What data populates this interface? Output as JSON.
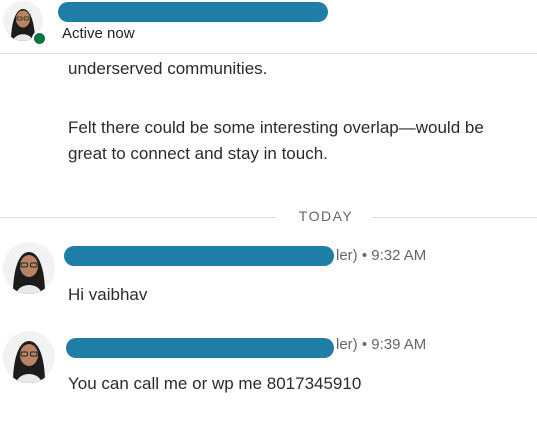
{
  "header": {
    "contact_name": "",
    "status": "Active now"
  },
  "conversation": {
    "earlier_message": {
      "line1": "underserved communities.",
      "line2": "Felt there could be some interesting overlap—would be",
      "line3": "great to connect and stay in touch."
    },
    "divider_label": "TODAY",
    "messages": [
      {
        "sender_suffix": "ler)",
        "time": " • 9:32 AM",
        "text": "Hi vaibhav"
      },
      {
        "sender_suffix": "ler)",
        "time": " • 9:39 AM",
        "text": "You can call me or wp me 8017345910"
      }
    ]
  },
  "colors": {
    "redaction": "#1f7ea8",
    "online_status": "#057642"
  }
}
